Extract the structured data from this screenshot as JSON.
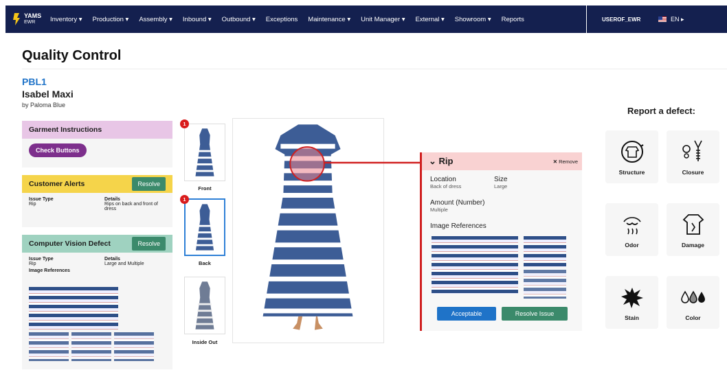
{
  "nav": {
    "brand_main": "YAMS",
    "brand_sub": "EWR",
    "items": [
      "Inventory ▾",
      "Production ▾",
      "Assembly ▾",
      "Inbound ▾",
      "Outbound ▾",
      "Exceptions",
      "Maintenance ▾",
      "Unit Manager ▾",
      "External ▾",
      "Showroom ▾",
      "Reports"
    ],
    "user": "USEROF_EWR",
    "lang": "EN ▸"
  },
  "page": {
    "title": "Quality Control",
    "product_code": "PBL1",
    "product_name": "Isabel Maxi",
    "brand": "by Paloma Blue"
  },
  "garment": {
    "title": "Garment Instructions",
    "button": "Check Buttons"
  },
  "alerts": {
    "title": "Customer Alerts",
    "resolve": "Resolve",
    "issue_label": "Issue Type",
    "issue": "Rip",
    "details_label": "Details",
    "details": "Rips on back and front of dress"
  },
  "cv": {
    "title": "Computer Vision Defect",
    "resolve": "Resolve",
    "issue_label": "Issue Type",
    "issue": "Rip",
    "details_label": "Details",
    "details": "Large and Multiple",
    "refs_label": "Image References"
  },
  "thumbs": [
    {
      "label": "Front",
      "badge": "1"
    },
    {
      "label": "Back",
      "badge": "1"
    },
    {
      "label": "Inside Out",
      "badge": ""
    }
  ],
  "defect": {
    "title": "Rip",
    "remove": "Remove",
    "location_label": "Location",
    "location": "Back of dress",
    "size_label": "Size",
    "size": "Large",
    "amount_label": "Amount (Number)",
    "amount": "Multiple",
    "refs_label": "Image References",
    "acceptable": "Acceptable",
    "resolve_issue": "Resolve Issue"
  },
  "report": {
    "title": "Report a defect:",
    "cards": [
      "Structure",
      "Closure",
      "Odor",
      "Damage",
      "Stain",
      "Color"
    ]
  },
  "colors": {
    "nav_bg": "#14204f",
    "accent_blue": "#1f73c8",
    "purple": "#7d2f8c",
    "green": "#3b8a6b",
    "red": "#d02020"
  }
}
